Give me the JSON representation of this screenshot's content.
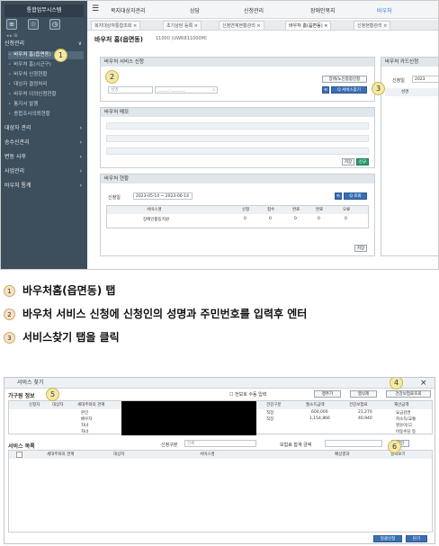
{
  "sidebar": {
    "title": "통합업무시스템",
    "mini": "◂ ▸ ⊞",
    "menus": [
      {
        "label": "신청관리",
        "caret": "∨"
      },
      {
        "label": "대상자 관리",
        "caret": "›"
      },
      {
        "label": "송수신관리",
        "caret": "›"
      },
      {
        "label": "변동 사후",
        "caret": "›"
      },
      {
        "label": "사업관리",
        "caret": "›"
      },
      {
        "label": "바우처 통계",
        "caret": "›"
      }
    ],
    "submenu": [
      "바우처 홈(읍면동)",
      "바우처 홈(시군구)",
      "바우처 신청현황",
      "대상자 결정처리",
      "바우처 이의신청현황",
      "통지서 발행",
      "종합조사의뢰현황"
    ]
  },
  "topbar": {
    "items": [
      "복지대상자관리",
      "상담",
      "신청관리",
      "장애인복지",
      "바우처"
    ],
    "hamburger": "☰"
  },
  "tabs": [
    "복지대상자통합조회 ×",
    "초기상담 등록 ×",
    "신청연계현황관리 ×",
    "바우처 홈(읍면동) ×",
    "신청현황관리 ×"
  ],
  "page": {
    "title": "바우처 홈(읍면동)",
    "code": "11000 (UWR811000M)"
  },
  "apply_panel": {
    "title": "바우처 서비스 신청",
    "name_placeholder": "성명",
    "rrn_placeholder": "______-_______",
    "search_icon": "⌕",
    "btn_area": "장애/노인종합신청",
    "btn_find": "Q 서비스찾기",
    "btn_reset": "⟲"
  },
  "memo_panel": {
    "title": "바우처 메모",
    "btn_save": "저장",
    "btn_new": "신규"
  },
  "status_panel": {
    "title": "바우처 현황",
    "date_label": "신청일",
    "date_range": "2023-05-14 ~ 2023-06-14",
    "btn_search": "Q 조회",
    "headers": [
      "서비스명",
      "신청",
      "접수",
      "완료",
      "완료",
      "오류"
    ],
    "rows": [
      [
        "장애인활동지원",
        "0",
        "0",
        "0",
        "0",
        "0"
      ]
    ],
    "btn_save": "저장"
  },
  "card_panel": {
    "title": "바우처 카드신청",
    "date_label": "신청일",
    "date_value": "2023",
    "col": "성명"
  },
  "steps": [
    {
      "num": "1",
      "text": "바우처홈(읍면동) 탭"
    },
    {
      "num": "2",
      "text": "바우처 서비스 신청에 신청인의 성명과 주민번호를 입력후 엔터"
    },
    {
      "num": "3",
      "text": "서비스찾기 탭을 클릭"
    }
  ],
  "callouts": [
    "1",
    "2",
    "3",
    "4",
    "5",
    "6"
  ],
  "popup": {
    "title": "서비스 찾기",
    "close": "×",
    "section1": "가구원 정보",
    "auto_input": "☐ 전보호 수동 입력",
    "btn_add": "행추가",
    "btn_del": "행삭제",
    "btn_health": "건강보험료조회",
    "family_headers": [
      "신청자",
      "대상자",
      "세대주와의 관계"
    ],
    "right_headers": [
      "건강구분",
      "월소득금액",
      "건강보험료",
      "재산금액"
    ],
    "family_rows": [
      {
        "rel": "본인",
        "type": "직장",
        "income": "600,000",
        "ins": "21,270",
        "note": "요금감면"
      },
      {
        "rel": "배우자",
        "type": "직장",
        "income": "1,154,866",
        "ins": "40,940",
        "note": "저소득/교통"
      },
      {
        "rel": "자녀",
        "type": "",
        "income": "",
        "ins": "",
        "note": "영유아/고"
      },
      {
        "rel": "자녀",
        "type": "",
        "income": "",
        "ins": "",
        "note": "아동수당 등"
      }
    ],
    "section2": "서비스 목록",
    "svc_filter_label": "신청구분",
    "svc_filter_value": "전체",
    "svc_total_label": "보험료 합계 금액",
    "btn_confirm": "확인",
    "svc_headers": [
      "세대주와의 관계",
      "대상자",
      "서비스명",
      "예상결과",
      "결과보기"
    ],
    "btn_apply": "일괄신청",
    "btn_close": "닫기"
  }
}
